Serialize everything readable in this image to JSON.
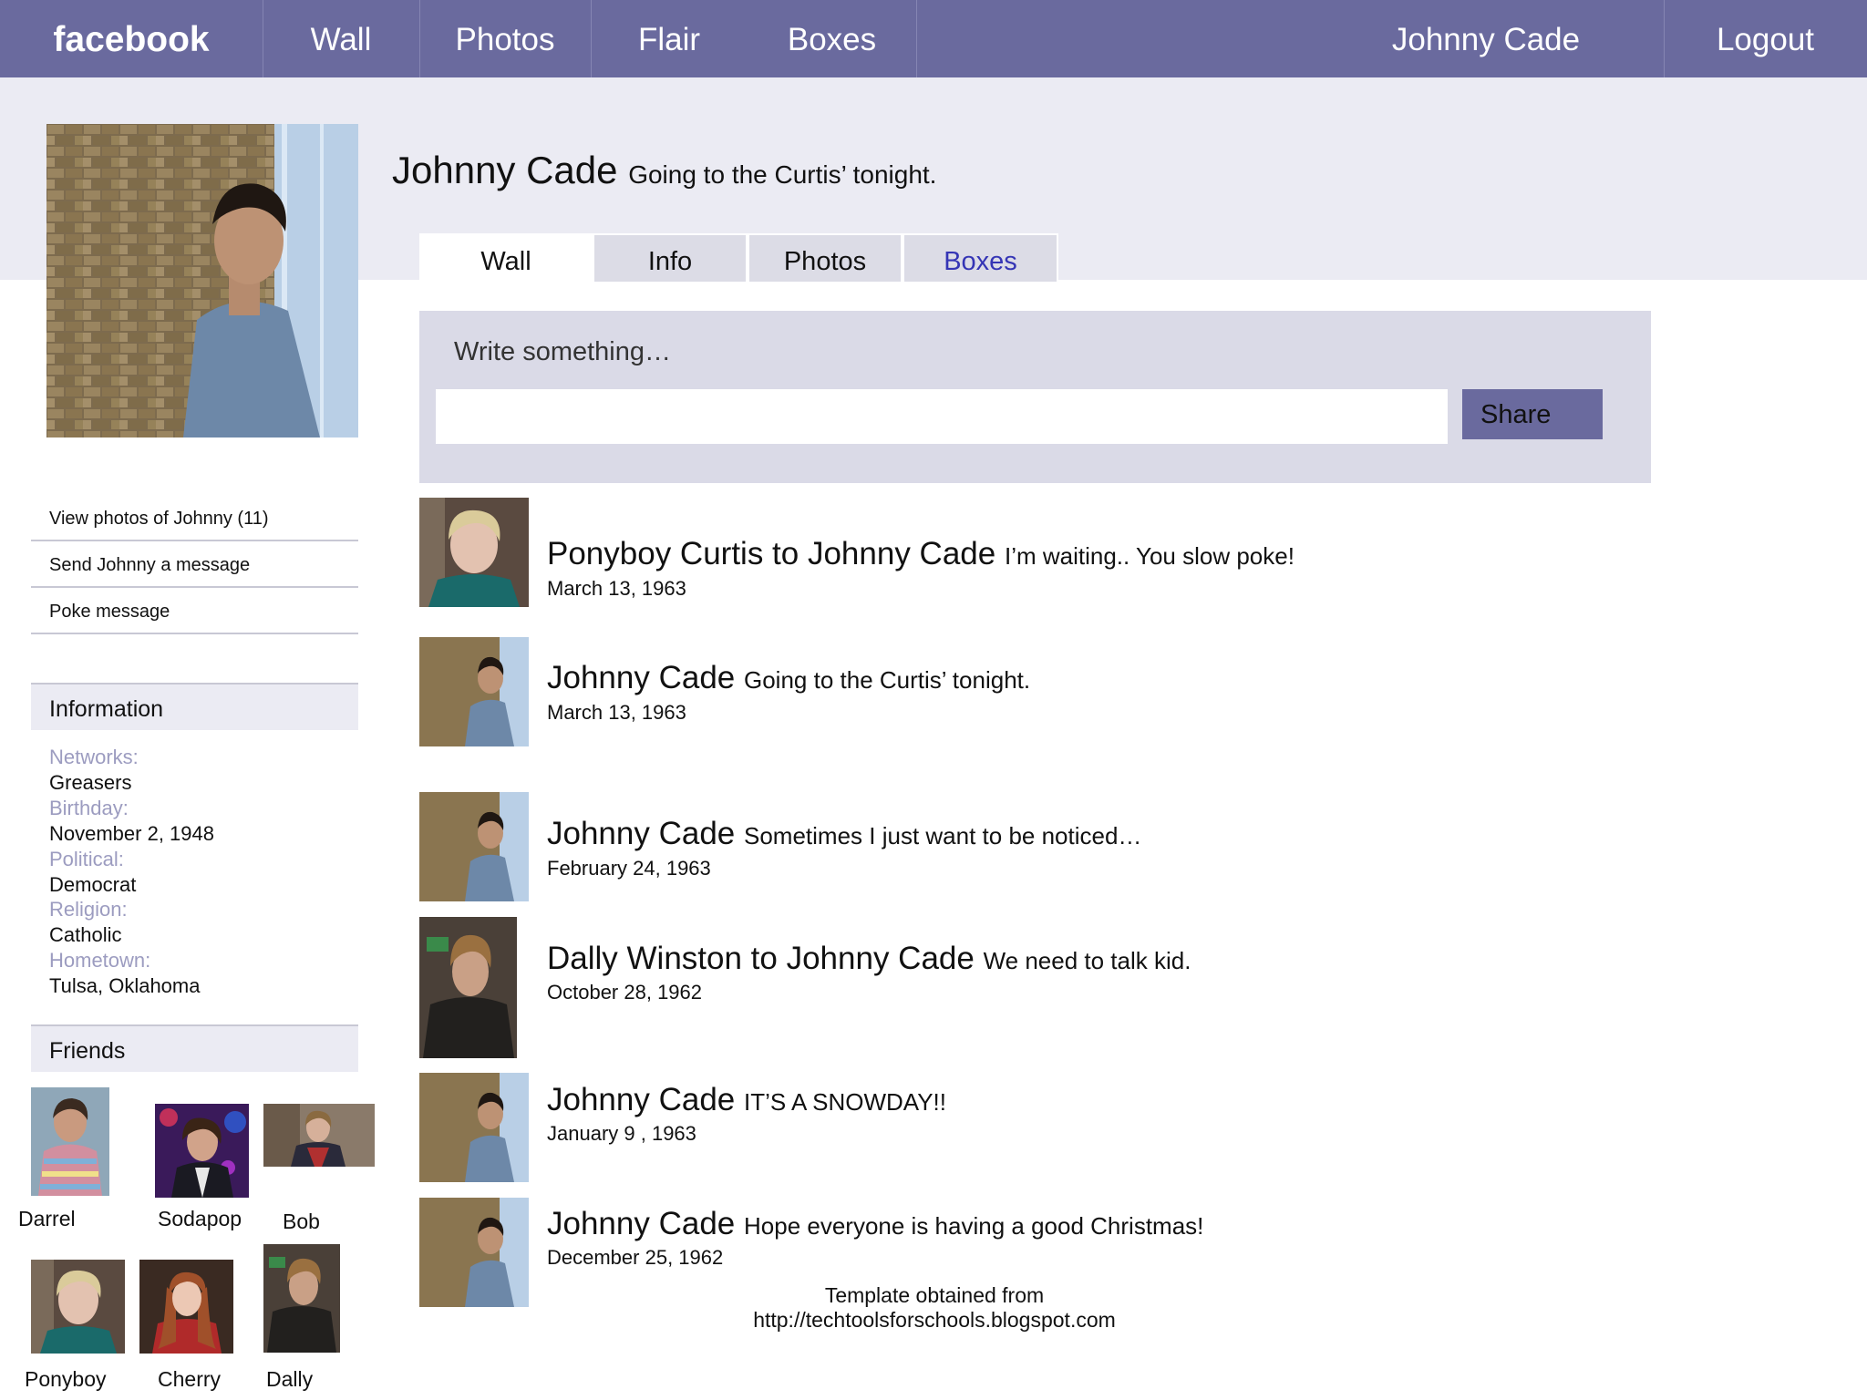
{
  "nav": {
    "logo": "facebook",
    "items": [
      "Wall",
      "Photos",
      "Flair",
      "Boxes"
    ],
    "user": "Johnny Cade",
    "logout": "Logout"
  },
  "profile": {
    "name": "Johnny Cade",
    "status": "Going to the Curtis’ tonight.",
    "tabs": [
      "Wall",
      "Info",
      "Photos",
      "Boxes"
    ]
  },
  "composer": {
    "label": "Write something…",
    "input_value": "",
    "share": "Share"
  },
  "sidebar": {
    "links": [
      "View photos of Johnny (11)",
      "Send Johnny a message",
      "Poke message"
    ],
    "information_heading": "Information",
    "info": [
      {
        "label": "Networks:",
        "value": "Greasers"
      },
      {
        "label": "Birthday:",
        "value": "November 2, 1948"
      },
      {
        "label": "Political:",
        "value": "Democrat"
      },
      {
        "label": "Religion:",
        "value": "Catholic"
      },
      {
        "label": "Hometown:",
        "value": "Tulsa, Oklahoma"
      }
    ],
    "friends_heading": "Friends",
    "friends": [
      "Darrel",
      "Sodapop",
      "Bob",
      "Ponyboy",
      "Cherry",
      "Dally"
    ]
  },
  "posts": [
    {
      "author": "Ponyboy Curtis to Johnny Cade",
      "message": "I’m waiting.. You slow poke!",
      "date": "March 13, 1963"
    },
    {
      "author": "Johnny Cade",
      "message": "Going to the Curtis’ tonight.",
      "date": "March 13, 1963"
    },
    {
      "author": "Johnny Cade",
      "message": "Sometimes I just want to be noticed…",
      "date": "February 24, 1963"
    },
    {
      "author": "Dally Winston to Johnny Cade",
      "message": "We need to talk kid.",
      "date": "October 28, 1962"
    },
    {
      "author": "Johnny Cade",
      "message": "IT’S A SNOWDAY!!",
      "date": "January 9 , 1963"
    },
    {
      "author": "Johnny Cade",
      "message": "Hope everyone is having a good Christmas!",
      "date": "December 25, 1962"
    }
  ],
  "footer": {
    "line1": "Template obtained from",
    "line2": "http://techtoolsforschools.blogspot.com"
  },
  "colors": {
    "nav_bg": "#6a6a9e",
    "band_bg": "#ebebf3",
    "composer_bg": "#dadae7",
    "boxes_tab": "#3535b5",
    "info_label": "#9c9cc0"
  }
}
